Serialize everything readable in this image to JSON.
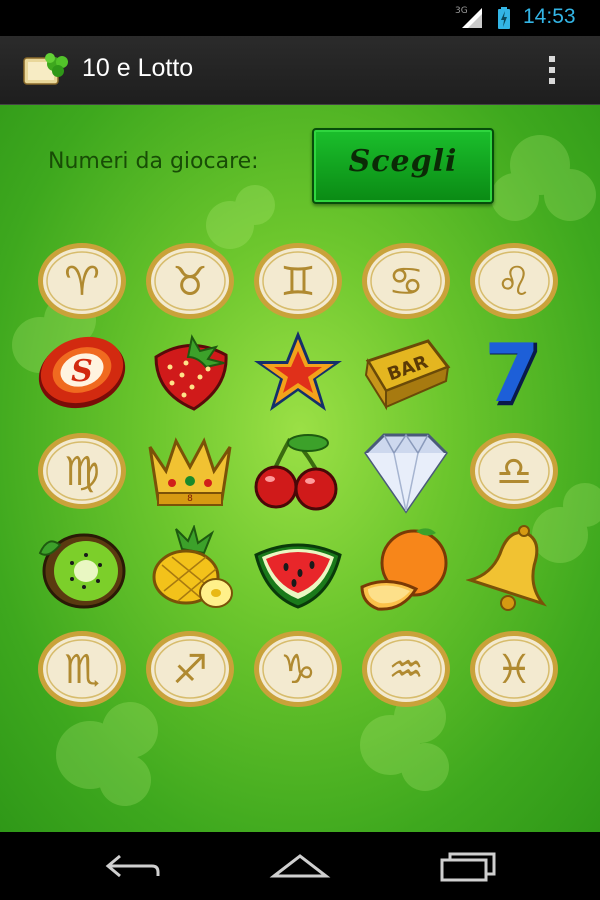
{
  "status_bar": {
    "network": "3G",
    "time": "14:53"
  },
  "app": {
    "title": "10 e Lotto"
  },
  "main": {
    "prompt_label": "Numeri da giocare:",
    "choose_button_label": "Scegli"
  },
  "grid": [
    [
      "aries",
      "taurus",
      "gemini",
      "cancer",
      "leo"
    ],
    [
      "token",
      "strawberry",
      "star",
      "bar",
      "seven"
    ],
    [
      "virgo",
      "crown",
      "cherries",
      "diamond",
      "libra"
    ],
    [
      "kiwi",
      "pineapple",
      "watermelon",
      "orange",
      "bell"
    ],
    [
      "scorpio",
      "sagittarius",
      "capricorn",
      "aquarius",
      "pisces"
    ]
  ],
  "symbol_texts": {
    "token": "S",
    "bar": "BAR",
    "seven": "7",
    "crown": "8"
  },
  "zodiac_glyphs": {
    "aries": "♈",
    "taurus": "♉",
    "gemini": "♊",
    "cancer": "♋",
    "leo": "♌",
    "virgo": "♍",
    "libra": "♎",
    "scorpio": "♏",
    "sagittarius": "♐",
    "capricorn": "♑",
    "aquarius": "♒",
    "pisces": "♓"
  },
  "colors": {
    "accent": "#33b5e5",
    "background_green": "#5cbf2a",
    "button_green": "#12a320",
    "gold": "#d4a21a"
  }
}
